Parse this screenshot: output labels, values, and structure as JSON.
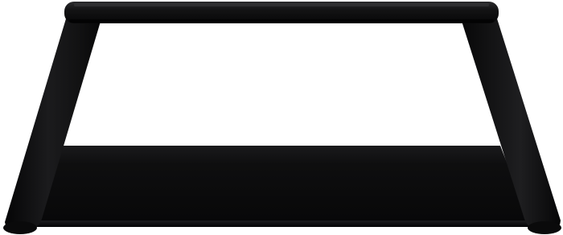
{
  "image": {
    "subject": "black-stand-product-photo",
    "background_color": "#ffffff",
    "product_color": "#0b0b0c",
    "highlight_color": "#2a2a2c",
    "shadow_color": "#000000"
  }
}
